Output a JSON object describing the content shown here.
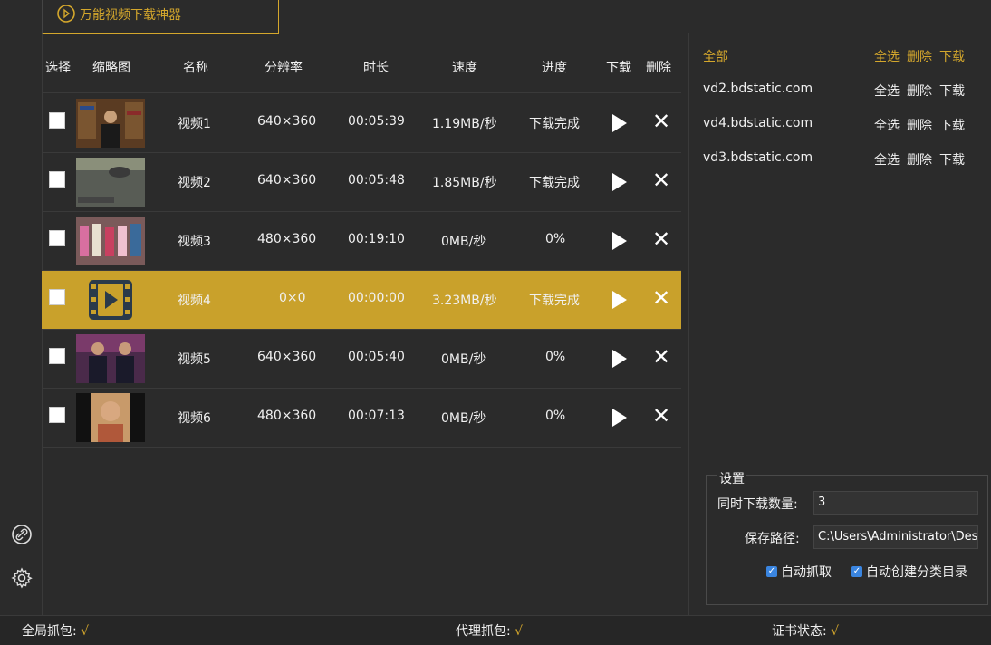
{
  "app": {
    "title": "万能视频下载神器"
  },
  "table": {
    "headers": {
      "select": "选择",
      "thumbnail": "缩略图",
      "name": "名称",
      "resolution": "分辨率",
      "duration": "时长",
      "speed": "速度",
      "progress": "进度",
      "download": "下载",
      "delete": "删除"
    },
    "rows": [
      {
        "name": "视频1",
        "resolution": "640×360",
        "duration": "00:05:39",
        "speed": "1.19MB/秒",
        "progress": "下载完成",
        "highlighted": false
      },
      {
        "name": "视频2",
        "resolution": "640×360",
        "duration": "00:05:48",
        "speed": "1.85MB/秒",
        "progress": "下载完成",
        "highlighted": false
      },
      {
        "name": "视频3",
        "resolution": "480×360",
        "duration": "00:19:10",
        "speed": "0MB/秒",
        "progress": "0%",
        "highlighted": false
      },
      {
        "name": "视频4",
        "resolution": "0×0",
        "duration": "00:00:00",
        "speed": "3.23MB/秒",
        "progress": "下载完成",
        "highlighted": true
      },
      {
        "name": "视频5",
        "resolution": "640×360",
        "duration": "00:05:40",
        "speed": "0MB/秒",
        "progress": "0%",
        "highlighted": false
      },
      {
        "name": "视频6",
        "resolution": "480×360",
        "duration": "00:07:13",
        "speed": "0MB/秒",
        "progress": "0%",
        "highlighted": false
      }
    ]
  },
  "hosts": {
    "all_label": "全部",
    "actions": {
      "select_all": "全选",
      "delete": "删除",
      "download": "下载"
    },
    "items": [
      "vd2.bdstatic.com",
      "vd4.bdstatic.com",
      "vd3.bdstatic.com"
    ]
  },
  "settings": {
    "title": "设置",
    "concurrent_label": "同时下载数量:",
    "concurrent_value": "3",
    "save_path_label": "保存路径:",
    "save_path_value": "C:\\Users\\Administrator\\Des",
    "auto_capture_label": "自动抓取",
    "auto_capture_checked": true,
    "auto_folder_label": "自动创建分类目录",
    "auto_folder_checked": true
  },
  "status": {
    "global_capture_label": "全局抓包:",
    "global_capture_value": "√",
    "proxy_capture_label": "代理抓包:",
    "proxy_capture_value": "√",
    "cert_label": "证书状态:",
    "cert_value": "√"
  },
  "colors": {
    "accent": "#d4a72c",
    "background": "#2b2b2b",
    "highlight_row": "#c9a12b",
    "checkbox_blue": "#3a85e0"
  },
  "icons": {
    "tab": "download-circle-icon",
    "link": "link-icon",
    "settings": "gear-icon",
    "play": "play-icon",
    "delete": "close-icon",
    "video_placeholder": "film-icon"
  }
}
